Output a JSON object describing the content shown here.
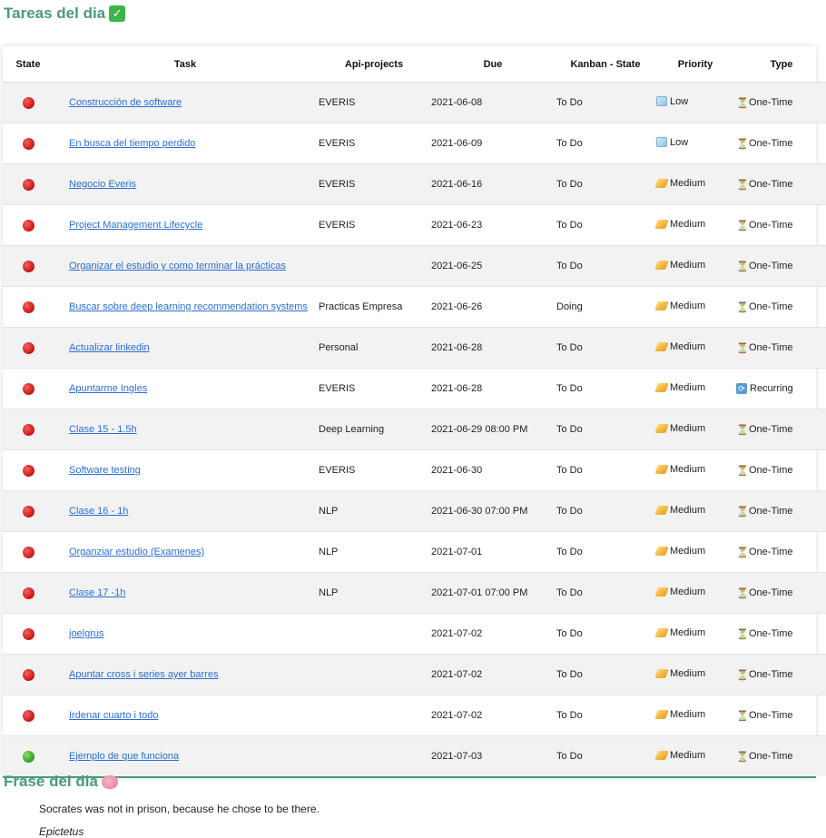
{
  "tasks_section": {
    "title": "Tareas del dia",
    "title_icon": "check-mark-icon",
    "columns": {
      "state": "State",
      "task": "Task",
      "project": "Api-projects",
      "due": "Due",
      "kanban": "Kanban - State",
      "priority": "Priority",
      "type": "Type"
    },
    "rows": [
      {
        "state": "red",
        "task": "Construcción de software",
        "project": "EVERIS",
        "due": "2021-06-08",
        "kanban": "To Do",
        "priority": "Low",
        "type": "One-Time"
      },
      {
        "state": "red",
        "task": "En busca del tiempo perdido",
        "project": "EVERIS",
        "due": "2021-06-09",
        "kanban": "To Do",
        "priority": "Low",
        "type": "One-Time"
      },
      {
        "state": "red",
        "task": "Negocio Everis",
        "project": "EVERIS",
        "due": "2021-06-16",
        "kanban": "To Do",
        "priority": "Medium",
        "type": "One-Time"
      },
      {
        "state": "red",
        "task": "Project Management Lifecycle",
        "project": "EVERIS",
        "due": "2021-06-23",
        "kanban": "To Do",
        "priority": "Medium",
        "type": "One-Time"
      },
      {
        "state": "red",
        "task": "Organizar el estudio y como terminar la prácticas",
        "project": "",
        "due": "2021-06-25",
        "kanban": "To Do",
        "priority": "Medium",
        "type": "One-Time"
      },
      {
        "state": "red",
        "task": "Buscar sobre deep learning recommendation systems",
        "project": "Practicas Empresa",
        "due": "2021-06-26",
        "kanban": "Doing",
        "priority": "Medium",
        "type": "One-Time"
      },
      {
        "state": "red",
        "task": "Actualizar linkedin",
        "project": "Personal",
        "due": "2021-06-28",
        "kanban": "To Do",
        "priority": "Medium",
        "type": "One-Time"
      },
      {
        "state": "red",
        "task": "Apuntarme Ingles",
        "project": "EVERIS",
        "due": "2021-06-28",
        "kanban": "To Do",
        "priority": "Medium",
        "type": "Recurring"
      },
      {
        "state": "red",
        "task": "Clase 15 - 1.5h",
        "project": "Deep Learning",
        "due": "2021-06-29 08:00 PM",
        "kanban": "To Do",
        "priority": "Medium",
        "type": "One-Time"
      },
      {
        "state": "red",
        "task": "Software testing",
        "project": "EVERIS",
        "due": "2021-06-30",
        "kanban": "To Do",
        "priority": "Medium",
        "type": "One-Time"
      },
      {
        "state": "red",
        "task": "Clase 16 - 1h",
        "project": "NLP",
        "due": "2021-06-30 07:00 PM",
        "kanban": "To Do",
        "priority": "Medium",
        "type": "One-Time"
      },
      {
        "state": "red",
        "task": "Organziar estudio (Examenes)",
        "project": "NLP",
        "due": "2021-07-01",
        "kanban": "To Do",
        "priority": "Medium",
        "type": "One-Time"
      },
      {
        "state": "red",
        "task": "Clase 17 -1h",
        "project": "NLP",
        "due": "2021-07-01 07:00 PM",
        "kanban": "To Do",
        "priority": "Medium",
        "type": "One-Time"
      },
      {
        "state": "red",
        "task": "joelgrus",
        "project": "",
        "due": "2021-07-02",
        "kanban": "To Do",
        "priority": "Medium",
        "type": "One-Time"
      },
      {
        "state": "red",
        "task": "Apuntar cross i series ayer barres",
        "project": "",
        "due": "2021-07-02",
        "kanban": "To Do",
        "priority": "Medium",
        "type": "One-Time"
      },
      {
        "state": "red",
        "task": "Irdenar cuarto i todo",
        "project": "",
        "due": "2021-07-02",
        "kanban": "To Do",
        "priority": "Medium",
        "type": "One-Time"
      },
      {
        "state": "green",
        "task": "Ejemplo de que funciona",
        "project": "",
        "due": "2021-07-03",
        "kanban": "To Do",
        "priority": "Medium",
        "type": "One-Time"
      }
    ]
  },
  "quote_section": {
    "title": "Frase del dia",
    "title_icon": "brain-icon",
    "text": "Socrates was not in prison, because he chose to be there.",
    "author": "Epictetus"
  }
}
